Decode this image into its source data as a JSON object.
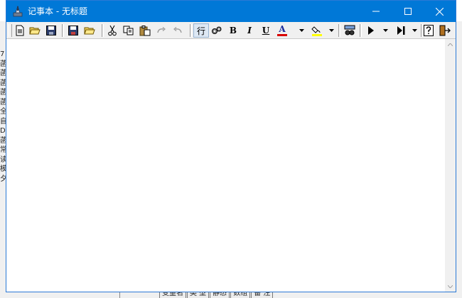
{
  "window": {
    "title": "记事本 - 无标题",
    "accent": "#0078d7"
  },
  "toolbar": {
    "line_label": "行",
    "bold_label": "B",
    "italic_label": "I",
    "underline_label": "U",
    "font_color_label": "A",
    "font_color": "#d80000",
    "fill_color": "#ffff00",
    "icons": [
      "new-file-icon",
      "open-folder-icon",
      "save-icon",
      "save-all-icon",
      "open-icon",
      "cut-icon",
      "copy-icon",
      "paste-icon",
      "redo-icon",
      "undo-icon",
      "line-icon",
      "settings-icon",
      "bold-icon",
      "italic-icon",
      "underline-icon",
      "font-color-icon",
      "fill-color-icon",
      "find-replace-icon",
      "run-icon",
      "step-icon",
      "help-icon",
      "exit-icon"
    ]
  },
  "background": {
    "left_glyphs": [
      "7",
      "菡",
      "菡",
      "菡",
      "菡",
      "菡",
      "全",
      "自",
      "D",
      "菡",
      "常",
      "读",
      "模",
      "夕"
    ],
    "bottom_tabs": [
      "变量名",
      "类 型",
      "静态",
      "数组",
      "备 注"
    ]
  }
}
